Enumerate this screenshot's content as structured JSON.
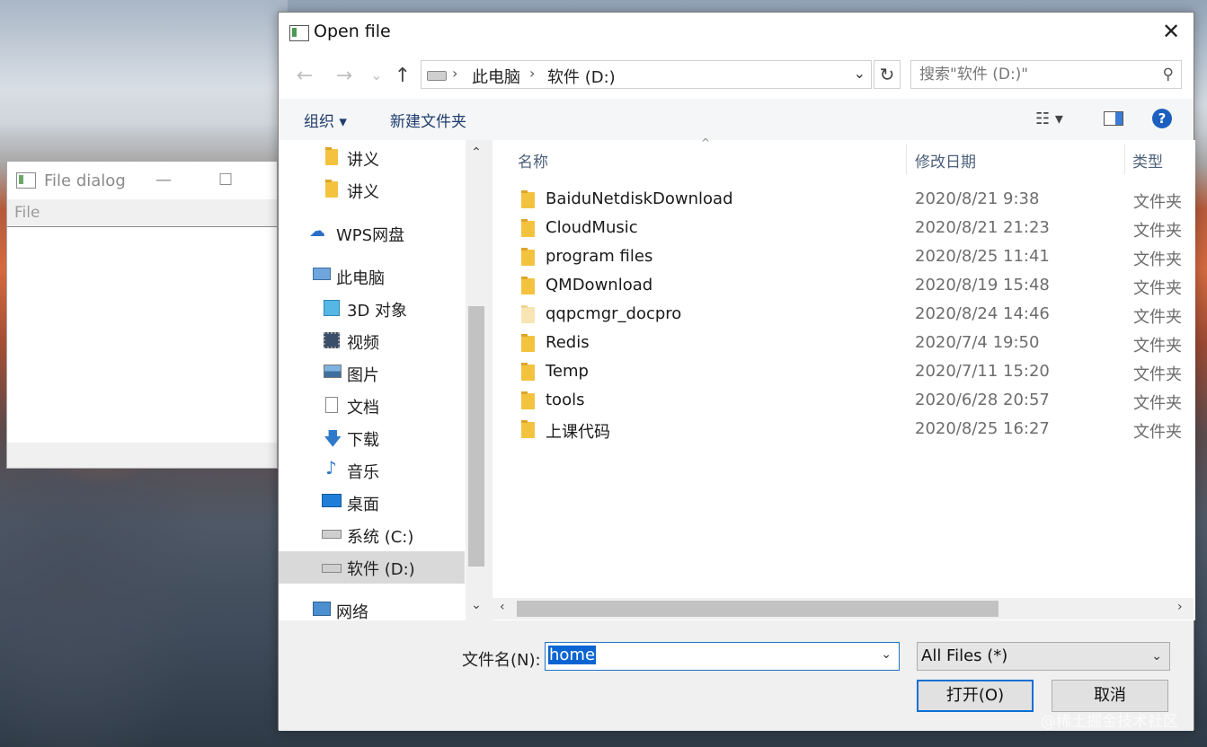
{
  "background_window": {
    "title": "File dialog",
    "minimize_glyph": "—",
    "maximize_glyph": "☐",
    "menu_file": "File"
  },
  "dialog": {
    "title": "Open file",
    "close_glyph": "✕",
    "nav": {
      "back_glyph": "←",
      "forward_glyph": "→",
      "recent_glyph": "⌄",
      "up_glyph": "↑",
      "breadcrumb": [
        "此电脑",
        "软件 (D:)"
      ],
      "breadcrumb_sep": "›",
      "address_drop": "⌄",
      "refresh_glyph": "↻",
      "search_placeholder": "搜索\"软件 (D:)\"",
      "search_glyph": "⚲"
    },
    "toolbar": {
      "organize": "组织 ▾",
      "new_folder": "新建文件夹",
      "view_glyph": "☷ ▾",
      "help_glyph": "?"
    },
    "sidebar": {
      "items": [
        {
          "label": "讲义",
          "icon": "folder-icon"
        },
        {
          "label": "讲义",
          "icon": "folder-icon"
        },
        {
          "label": "WPS网盘",
          "icon": "cloud-icon"
        },
        {
          "label": "此电脑",
          "icon": "computer-icon"
        },
        {
          "label": "3D 对象",
          "icon": "3d-objects-icon"
        },
        {
          "label": "视频",
          "icon": "video-icon"
        },
        {
          "label": "图片",
          "icon": "pictures-icon"
        },
        {
          "label": "文档",
          "icon": "documents-icon"
        },
        {
          "label": "下载",
          "icon": "download-icon"
        },
        {
          "label": "音乐",
          "icon": "music-icon"
        },
        {
          "label": "桌面",
          "icon": "desktop-icon"
        },
        {
          "label": "系统 (C:)",
          "icon": "windows-drive-icon"
        },
        {
          "label": "软件 (D:)",
          "icon": "drive-icon"
        },
        {
          "label": "网络",
          "icon": "network-icon"
        }
      ],
      "selected_index": 12,
      "scroll_up": "⌃",
      "scroll_down": "⌄"
    },
    "columns": {
      "name": "名称",
      "date": "修改日期",
      "type": "类型",
      "sort_caret": "^"
    },
    "files": [
      {
        "name": "BaiduNetdiskDownload",
        "date": "2020/8/21 9:38",
        "type": "文件夹"
      },
      {
        "name": "CloudMusic",
        "date": "2020/8/21 21:23",
        "type": "文件夹"
      },
      {
        "name": "program files",
        "date": "2020/8/25 11:41",
        "type": "文件夹"
      },
      {
        "name": "QMDownload",
        "date": "2020/8/19 15:48",
        "type": "文件夹"
      },
      {
        "name": "qqpcmgr_docpro",
        "date": "2020/8/24 14:46",
        "type": "文件夹"
      },
      {
        "name": "Redis",
        "date": "2020/7/4 19:50",
        "type": "文件夹"
      },
      {
        "name": "Temp",
        "date": "2020/7/11 15:20",
        "type": "文件夹"
      },
      {
        "name": "tools",
        "date": "2020/6/28 20:57",
        "type": "文件夹"
      },
      {
        "name": "上课代码",
        "date": "2020/8/25 16:27",
        "type": "文件夹"
      }
    ],
    "hscroll": {
      "left": "‹",
      "right": "›"
    },
    "bottom": {
      "filename_label": "文件名(N):",
      "filename_value": "home",
      "filename_drop": "⌄",
      "filter_value": "All Files  (*)",
      "filter_drop": "⌄",
      "open_button": "打开(O)",
      "cancel_button": "取消"
    }
  },
  "watermark": "@稀土掘金技术社区"
}
